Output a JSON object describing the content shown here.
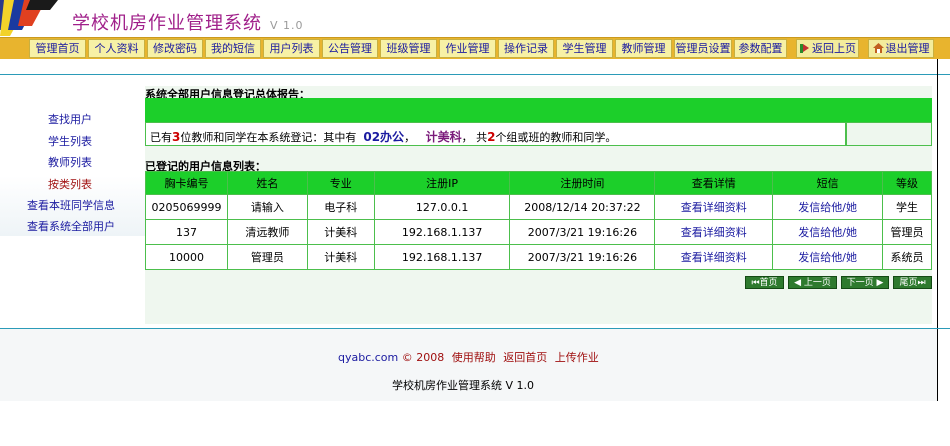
{
  "header": {
    "title": "学校机房作业管理系统",
    "version": "V 1.0"
  },
  "nav": {
    "items": [
      "管理首页",
      "个人资料",
      "修改密码",
      "我的短信",
      "用户列表",
      "公告管理",
      "班级管理",
      "作业管理",
      "操作记录",
      "学生管理",
      "教师管理",
      "管理员设置",
      "参数配置"
    ],
    "back_home": "返回上页",
    "logout": "退出管理"
  },
  "sidebar": {
    "items": [
      "查找用户",
      "学生列表",
      "教师列表",
      "按类列表",
      "查看本班同学信息",
      "查看系统全部用户"
    ]
  },
  "report": {
    "title": "系统全部用户信息登记总体报告：",
    "prefix": "已有",
    "total": "3",
    "mid": "位教师和同学在本系统登记：其中有",
    "class1": "02办公",
    "class2": "计美科",
    "suffix_pre": "，  共",
    "groups": "2",
    "suffix": "个组或班的教师和同学。"
  },
  "list": {
    "title": "已登记的用户信息列表：",
    "columns": [
      "胸卡编号",
      "姓名",
      "专业",
      "注册IP",
      "注册时间",
      "查看详情",
      "短信",
      "等级"
    ],
    "rows": [
      [
        "0205069999",
        "请输入",
        "电子科",
        "127.0.0.1",
        "2008/12/14 20:37:22",
        "查看详细资料",
        "发信给他/她",
        "学生"
      ],
      [
        "137",
        "清远教师",
        "计美科",
        "192.168.1.137",
        "2007/3/21 19:16:26",
        "查看详细资料",
        "发信给他/她",
        "管理员"
      ],
      [
        "10000",
        "管理员",
        "计美科",
        "192.168.1.137",
        "2007/3/21 19:16:26",
        "查看详细资料",
        "发信给他/她",
        "系统员"
      ]
    ]
  },
  "pager": {
    "first": "首页",
    "prev": "上一页",
    "next": "下一页",
    "last": "尾页"
  },
  "footer": {
    "site": "qyabc.com",
    "copyright": "© 2008",
    "help": "使用帮助",
    "home": "返回首页",
    "upload": "上传作业",
    "line2": "学校机房作业管理系统 V 1.0"
  },
  "colors": {
    "accent_green": "#1ccf2a",
    "nav_bar": "#e8b42e",
    "title_purple": "#a0208a",
    "link_blue": "#1a1aa0"
  }
}
